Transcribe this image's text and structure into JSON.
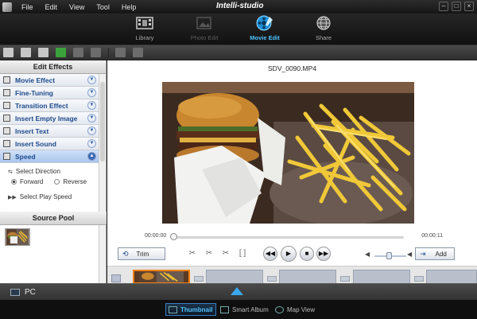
{
  "titlebar": {
    "app_title": "Intelli-studio",
    "menu": [
      "File",
      "Edit",
      "View",
      "Tool",
      "Help"
    ],
    "window_buttons": [
      "–",
      "□",
      "×"
    ]
  },
  "modes": [
    {
      "label": "Library",
      "state": "normal"
    },
    {
      "label": "Photo Edit",
      "state": "disabled"
    },
    {
      "label": "Movie Edit",
      "state": "active"
    },
    {
      "label": "Share",
      "state": "normal"
    }
  ],
  "edit_effects": {
    "header": "Edit Effects",
    "items": [
      {
        "label": "Movie Effect",
        "icon": "film-icon"
      },
      {
        "label": "Fine-Tuning",
        "icon": "tuning-icon"
      },
      {
        "label": "Transition Effect",
        "icon": "transition-icon"
      },
      {
        "label": "Insert Empty Image",
        "icon": "image-icon"
      },
      {
        "label": "Insert Text",
        "icon": "text-icon"
      },
      {
        "label": "Insert Sound",
        "icon": "sound-icon"
      },
      {
        "label": "Speed",
        "icon": "speed-icon",
        "expanded": true
      }
    ],
    "speed": {
      "select_direction": "Select Direction",
      "forward": "Forward",
      "reverse": "Reverse",
      "selected": "Forward",
      "select_play_speed": "Select Play Speed"
    }
  },
  "source_pool": {
    "header": "Source Pool"
  },
  "player": {
    "filename": "SDV_0090.MP4",
    "time_start": "00:00:00",
    "time_end": "00:00:11",
    "position_fraction": 0.0,
    "trim_label": "Trim",
    "add_label": "Add",
    "volume_fraction": 0.45
  },
  "bottom": {
    "source_label": "PC",
    "views": [
      {
        "label": "Thumbnail",
        "active": true
      },
      {
        "label": "Smart Album",
        "active": false
      },
      {
        "label": "Map View",
        "active": false
      }
    ]
  },
  "colors": {
    "accent": "#4fc3ff",
    "selection_border": "#f27f0f",
    "effect_label": "#1e4a8c"
  }
}
